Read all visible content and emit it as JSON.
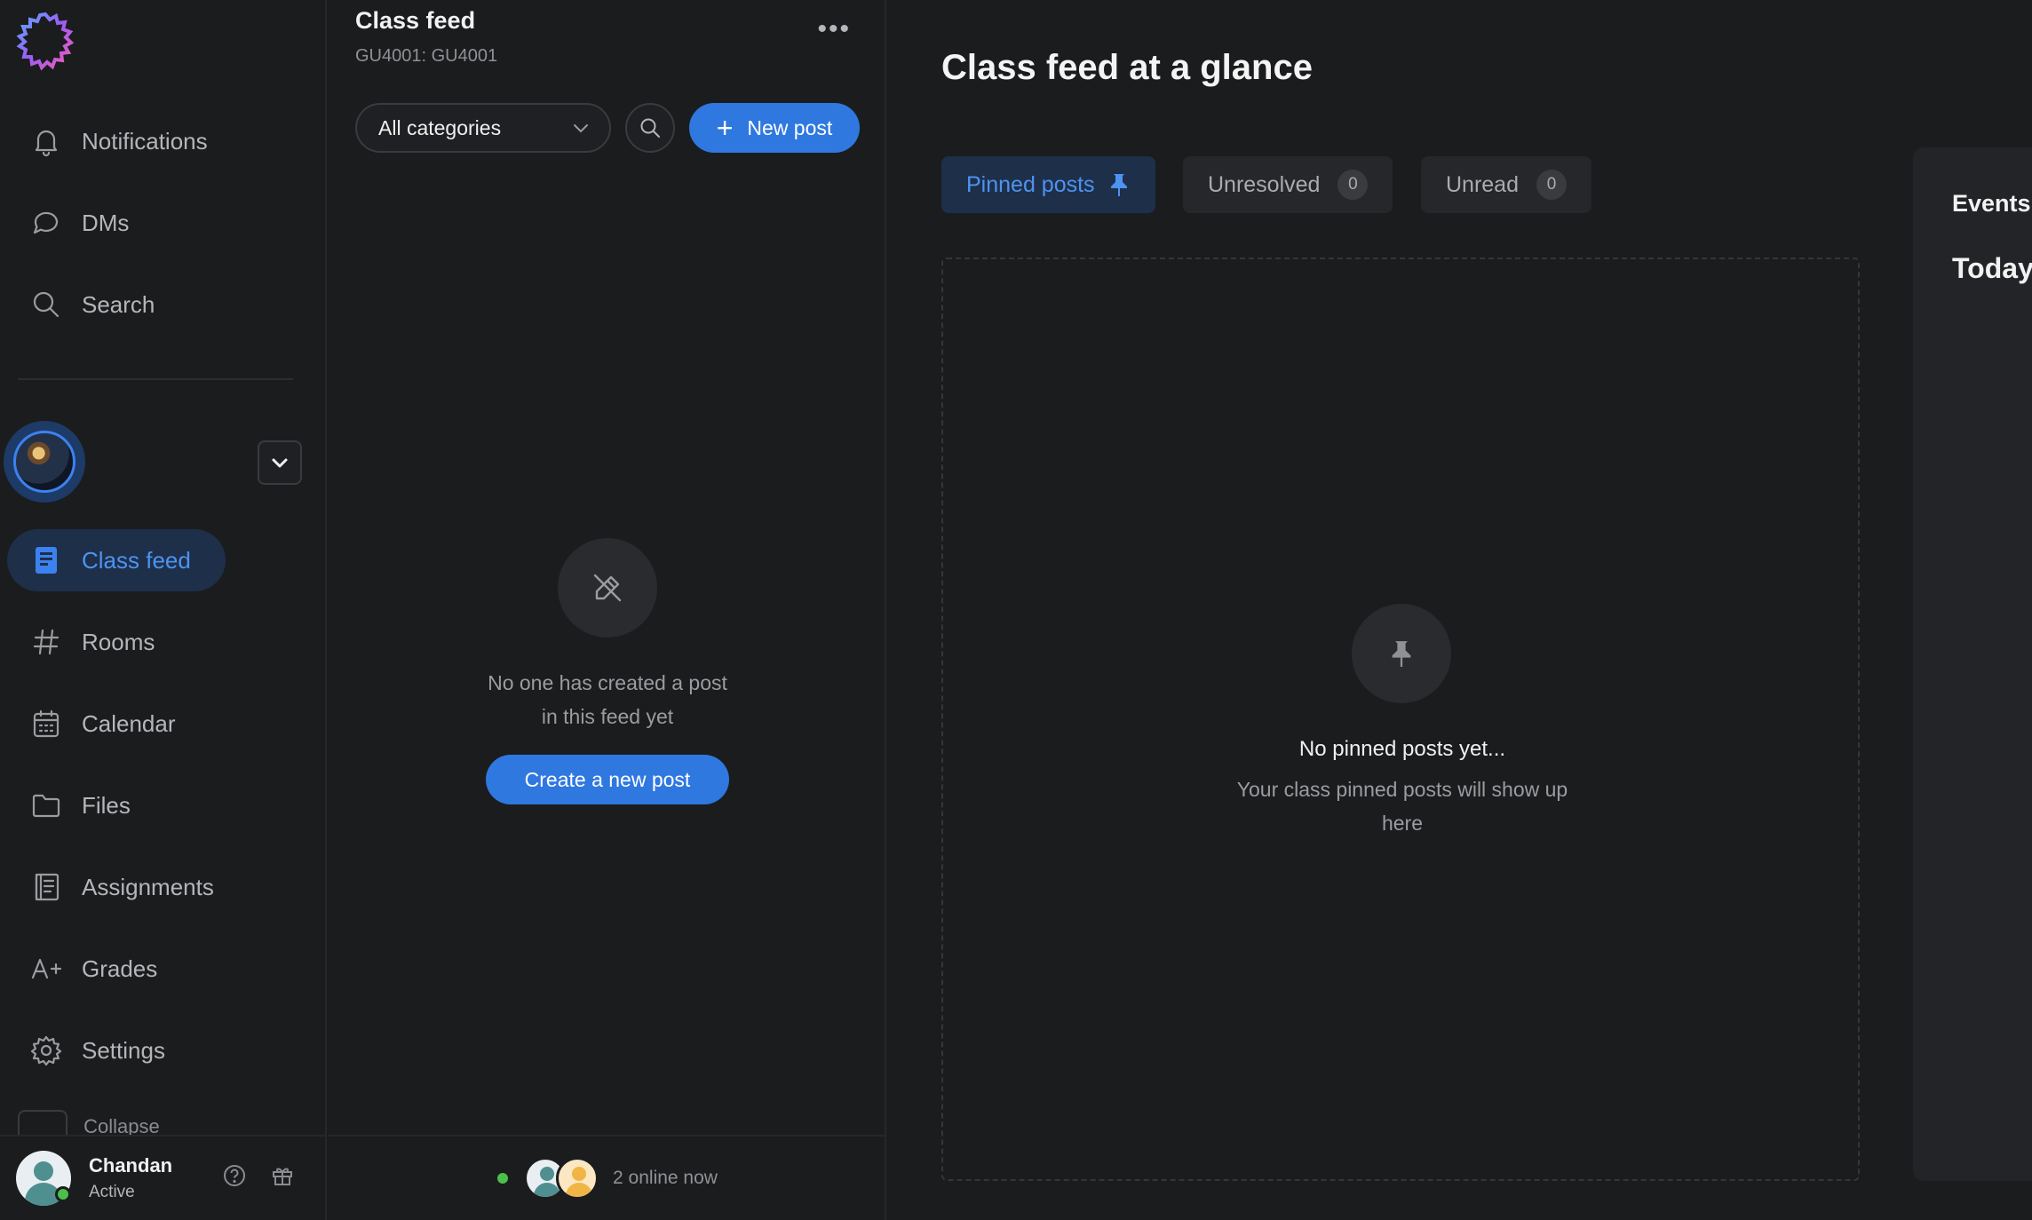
{
  "sidebar": {
    "nav_top": [
      {
        "label": "Notifications",
        "icon": "bell-icon"
      },
      {
        "label": "DMs",
        "icon": "chat-bubble-icon"
      },
      {
        "label": "Search",
        "icon": "search-icon"
      }
    ],
    "nav_class": [
      {
        "label": "Class feed",
        "icon": "feed-icon",
        "active": true
      },
      {
        "label": "Rooms",
        "icon": "hash-icon"
      },
      {
        "label": "Calendar",
        "icon": "calendar-icon"
      },
      {
        "label": "Files",
        "icon": "folder-icon"
      },
      {
        "label": "Assignments",
        "icon": "assignments-icon"
      },
      {
        "label": "Grades",
        "icon": "grades-icon"
      },
      {
        "label": "Settings",
        "icon": "gear-icon"
      }
    ],
    "collapse_label": "Collapse",
    "user": {
      "name": "Chandan",
      "status": "Active"
    }
  },
  "feed": {
    "title": "Class feed",
    "subtitle": "GU4001: GU4001",
    "category_select": "All categories",
    "new_post_label": "New post",
    "empty_line1": "No one has created a post",
    "empty_line2": "in this feed yet",
    "create_label": "Create a new post",
    "online_text": "2 online now"
  },
  "main": {
    "title": "Class feed at a glance",
    "tabs": [
      {
        "label": "Pinned posts",
        "active": true
      },
      {
        "label": "Unresolved",
        "count": "0"
      },
      {
        "label": "Unread",
        "count": "0"
      }
    ],
    "pinned_empty_title": "No pinned posts yet...",
    "pinned_empty_sub": "Your class pinned posts will show up here",
    "events_title": "Events",
    "today_title": "Today"
  },
  "colors": {
    "accent": "#2f78e0",
    "background": "#1b1c1e",
    "active_bg": "#1e2f4a",
    "online": "#4bbf4b"
  }
}
